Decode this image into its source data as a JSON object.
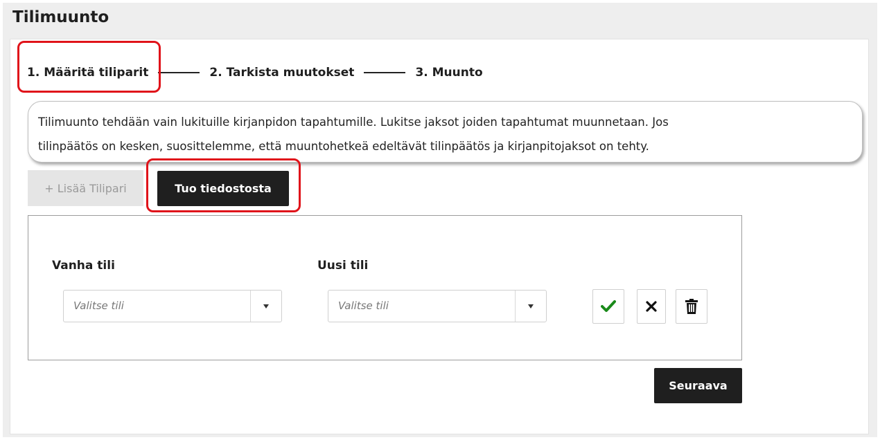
{
  "panel": {
    "title": "Tilimuunto"
  },
  "steps": [
    {
      "label": "1. Määritä tiliparit"
    },
    {
      "label": "2. Tarkista muutokset"
    },
    {
      "label": "3. Muunto"
    }
  ],
  "info": {
    "line1": "Tilimuunto tehdään vain lukituille kirjanpidon tapahtumille. Lukitse jaksot joiden tapahtumat muunnetaan. Jos",
    "line2": "tilinpäätös on kesken, suosittelemme, että muuntohetkeä edeltävät tilinpäätös ja kirjanpitojaksot on tehty."
  },
  "toolbar": {
    "add_label": "+ Lisää Tilipari",
    "import_label": "Tuo tiedostosta"
  },
  "table": {
    "old_header": "Vanha tili",
    "new_header": "Uusi tili",
    "old_placeholder": "Valitse tili",
    "new_placeholder": "Valitse tili"
  },
  "footer": {
    "next_label": "Seuraava"
  },
  "icons": {
    "confirm": "check-icon",
    "cancel": "close-icon",
    "delete": "trash-icon"
  },
  "colors": {
    "highlight": "#e0131a",
    "dark_button": "#1f1f1f",
    "check": "#1a8a1a"
  }
}
